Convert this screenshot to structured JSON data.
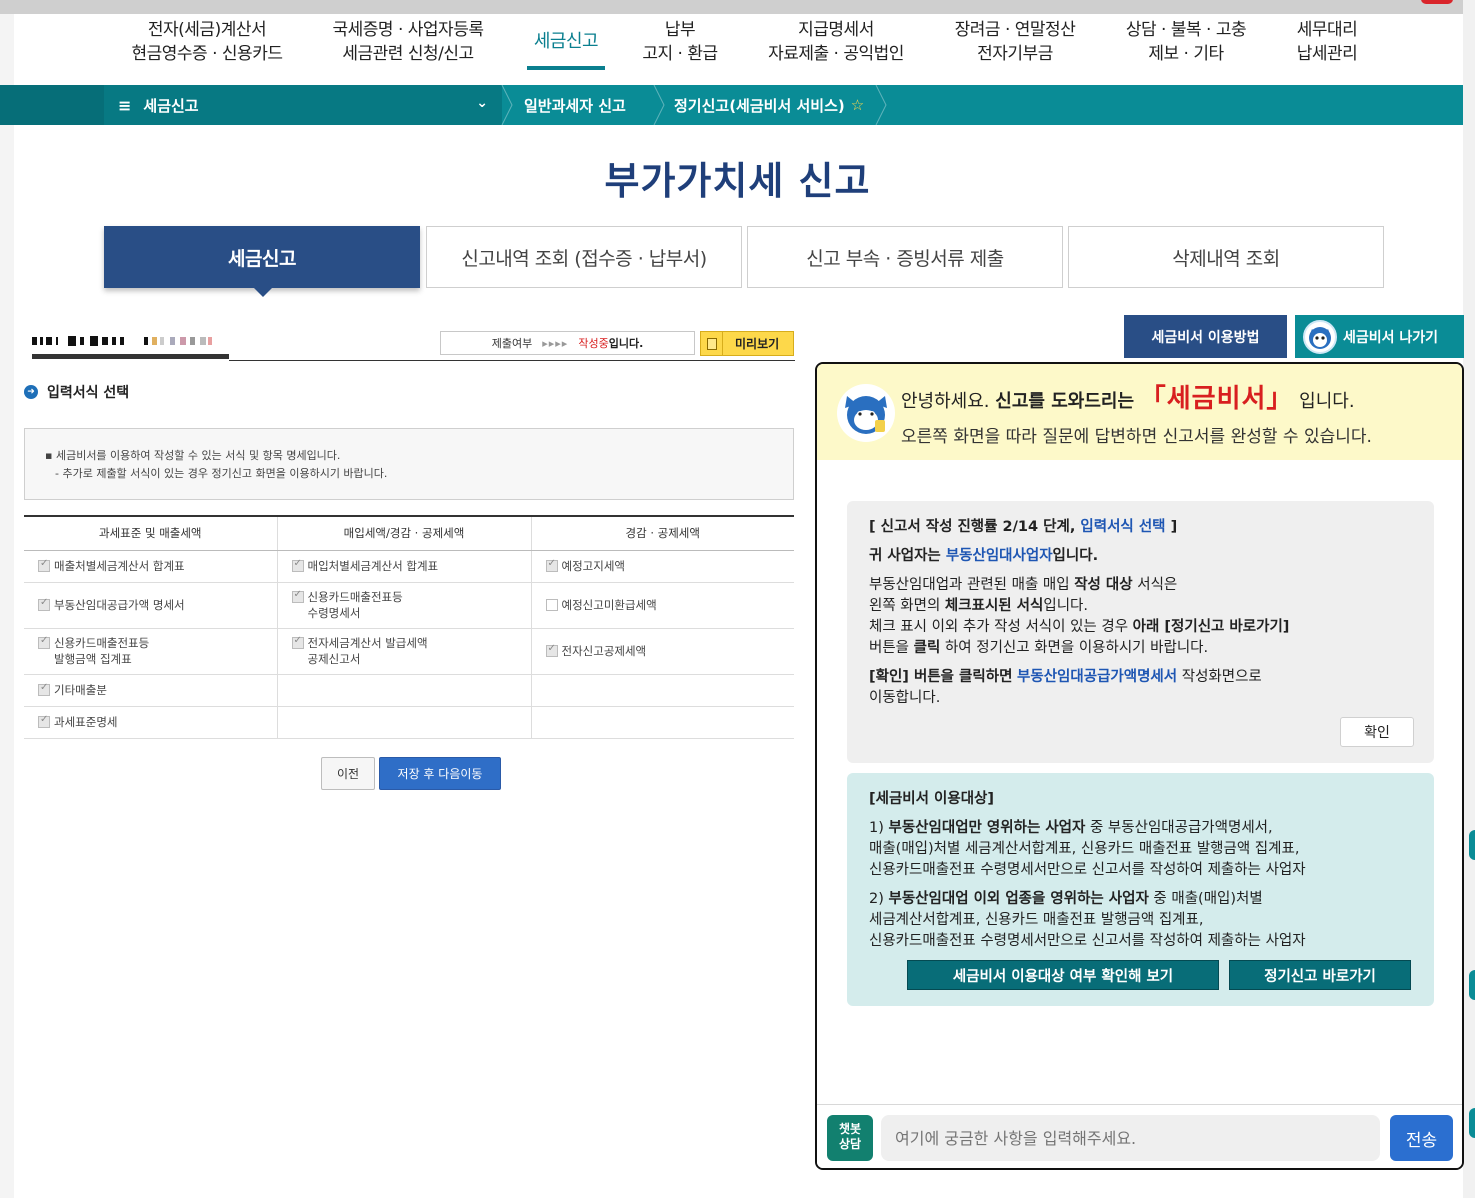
{
  "nav": {
    "items": [
      {
        "line1": "전자(세금)계산서",
        "line2": "현금영수증 · 신용카드"
      },
      {
        "line1": "국세증명 · 사업자등록",
        "line2": "세금관련 신청/신고"
      },
      {
        "line1": "세금신고",
        "line2": ""
      },
      {
        "line1": "납부",
        "line2": "고지 · 환급"
      },
      {
        "line1": "지급명세서",
        "line2": "자료제출 · 공익법인"
      },
      {
        "line1": "장려금 · 연말정산",
        "line2": "전자기부금"
      },
      {
        "line1": "상담 · 불복 · 고충",
        "line2": "제보 · 기타"
      },
      {
        "line1": "세무대리",
        "line2": "납세관리"
      }
    ]
  },
  "breadcrumb": {
    "menu": "세금신고",
    "crumb1": "일반과세자 신고",
    "crumb2": "정기신고(세금비서 서비스)",
    "star": "☆"
  },
  "page": {
    "title": "부가가치세 신고"
  },
  "tabs": [
    {
      "label": "세금신고"
    },
    {
      "label": "신고내역 조회 (접수증 · 납부서)"
    },
    {
      "label": "신고 부속 · 증빙서류 제출"
    },
    {
      "label": "삭제내역 조회"
    }
  ],
  "status": {
    "label": "제출여부",
    "arrows": "▸▸▸▸",
    "writing": "작성중",
    "writing_tail": "입니다.",
    "preview": "미리보기"
  },
  "form": {
    "section_title": "입력서식 선택",
    "info_line1": "세금비서를 이용하여 작성할 수 있는 서식 및 항목 명세입니다.",
    "info_line2": "- 추가로 제출할 서식이 있는 경우 정기신고 화면을 이용하시기 바랍니다.",
    "columns": [
      "과세표준 및 매출세액",
      "매입세액/경감 · 공제세액",
      "경감 · 공제세액"
    ],
    "rows": [
      [
        {
          "lines": [
            "매출처별세금계산서 합계표"
          ],
          "checked": true
        },
        {
          "lines": [
            "매입처별세금계산서 합계표"
          ],
          "checked": true
        },
        {
          "lines": [
            "예정고지세액"
          ],
          "checked": true
        }
      ],
      [
        {
          "lines": [
            "부동산임대공급가액 명세서"
          ],
          "checked": true
        },
        {
          "lines": [
            "신용카드매출전표등",
            "수령명세서"
          ],
          "checked": true
        },
        {
          "lines": [
            "예정신고미환급세액"
          ],
          "checked": false
        }
      ],
      [
        {
          "lines": [
            "신용카드매출전표등",
            "발행금액 집계표"
          ],
          "checked": true
        },
        {
          "lines": [
            "전자세금계산서 발급세액",
            "공제신고서"
          ],
          "checked": true
        },
        {
          "lines": [
            "전자신고공제세액"
          ],
          "checked": true
        }
      ],
      [
        {
          "lines": [
            "기타매출분"
          ],
          "checked": true
        },
        null,
        null
      ],
      [
        {
          "lines": [
            "과세표준명세"
          ],
          "checked": true
        },
        null,
        null
      ]
    ],
    "prev_btn": "이전",
    "next_btn": "저장 후 다음이동"
  },
  "assistant": {
    "help_btn": "세금비서 이용방법",
    "exit_btn": "세금비서 나가기",
    "greet_pre": "안녕하세요.",
    "greet_bold": "신고를 도와드리는",
    "greet_brand": "「세금비서」",
    "greet_post": "입니다.",
    "greet_line2": "오른쪽 화면을 따라 질문에 답변하면 신고서를 완성할 수 있습니다.",
    "progress_pre": "[ 신고서 작성 진행률 2/14 단계,",
    "progress_link": "입력서식 선택",
    "progress_post": "]",
    "biz_pre": "귀 사업자는",
    "biz_type": "부동산임대사업자",
    "biz_post": "입니다.",
    "p1_a": "부동산임대업과 관련된 매출 매입",
    "p1_b": "작성 대상",
    "p1_c": "서식은",
    "p2_a": "왼쪽 화면의",
    "p2_b": "체크표시된 서식",
    "p2_c": "입니다.",
    "p3_a": "체크 표시 이외 추가 작성 서식이 있는 경우",
    "p3_b": "아래 [정기신고 바로가기]",
    "p4_a": "버튼을",
    "p4_b": "클릭",
    "p4_c": "하여 정기신고 화면을 이용하시기 바랍니다.",
    "p5_a": "[확인] 버튼을 클릭하면",
    "p5_b": "부동산임대공급가액명세서",
    "p5_c": "작성화면으로",
    "p6": "이동합니다.",
    "ok_btn": "확인",
    "target_title": "[세금비서 이용대상]",
    "t1_a": "1)",
    "t1_b": "부동산임대업만 영위하는 사업자",
    "t1_c": "중 부동산임대공급가액명세서,",
    "t1_l2": "매출(매입)처별 세금계산서합계표, 신용카드 매출전표 발행금액 집계표,",
    "t1_l3": "신용카드매출전표 수령명세서만으로 신고서를 작성하여 제출하는 사업자",
    "t2_a": "2)",
    "t2_b": "부동산임대업 이외 업종을 영위하는 사업자",
    "t2_c": "중 매출(매입)처별",
    "t2_l2": "세금계산서합계표, 신용카드 매출전표 발행금액 집계표,",
    "t2_l3": "신용카드매출전표 수령명세서만으로 신고서를 작성하여 제출하는 사업자",
    "check_btn": "세금비서 이용대상 여부 확인해 보기",
    "goto_btn": "정기신고 바로가기",
    "chat_tag": "챗봇\n상담",
    "chat_placeholder": "여기에 궁금한 사항을 입력해주세요.",
    "send_btn": "전송"
  }
}
